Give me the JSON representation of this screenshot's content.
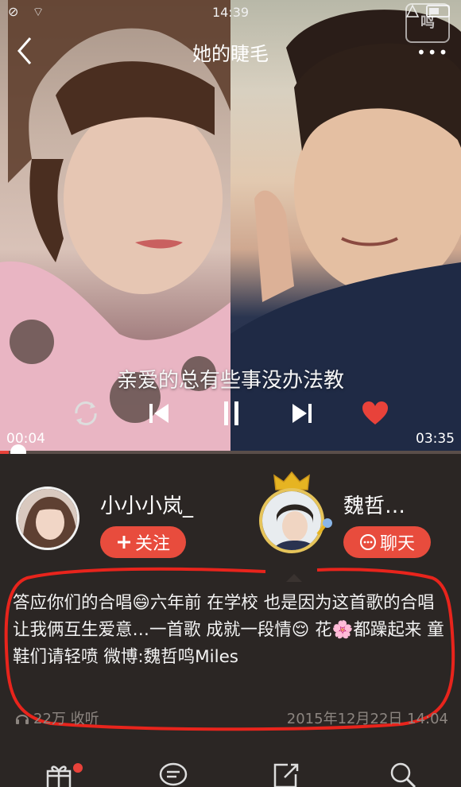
{
  "status_bar": {
    "time": "14:39"
  },
  "header": {
    "title": "她的睫毛",
    "logo_text": "鸣",
    "more": "•••"
  },
  "player": {
    "lyric": "亲爱的总有些事没办法教",
    "elapsed": "00:04",
    "duration": "03:35",
    "progress_fraction": 0.019
  },
  "singers": [
    {
      "name": "小小小岚_",
      "action_label": "关注",
      "action_icon": "plus-icon"
    },
    {
      "name": "魏哲…",
      "action_label": "聊天",
      "action_icon": "chat-bubble-icon"
    }
  ],
  "description": {
    "text": "答应你们的合唱😄六年前 在学校  也是因为这首歌的合唱 让我俩互生爱意…一首歌 成就一段情😌 花🌸都躁起来  童鞋们请轻喷   微博:魏哲鸣Miles",
    "listen_count": "22万 收听",
    "date": "2015年12月22日 14:04"
  },
  "colors": {
    "accent": "#e84c3d",
    "background": "#2b2624",
    "muted": "#8c8580"
  },
  "tabbar": {
    "items": [
      "gift-icon",
      "comment-icon",
      "share-icon",
      "search-icon"
    ]
  }
}
